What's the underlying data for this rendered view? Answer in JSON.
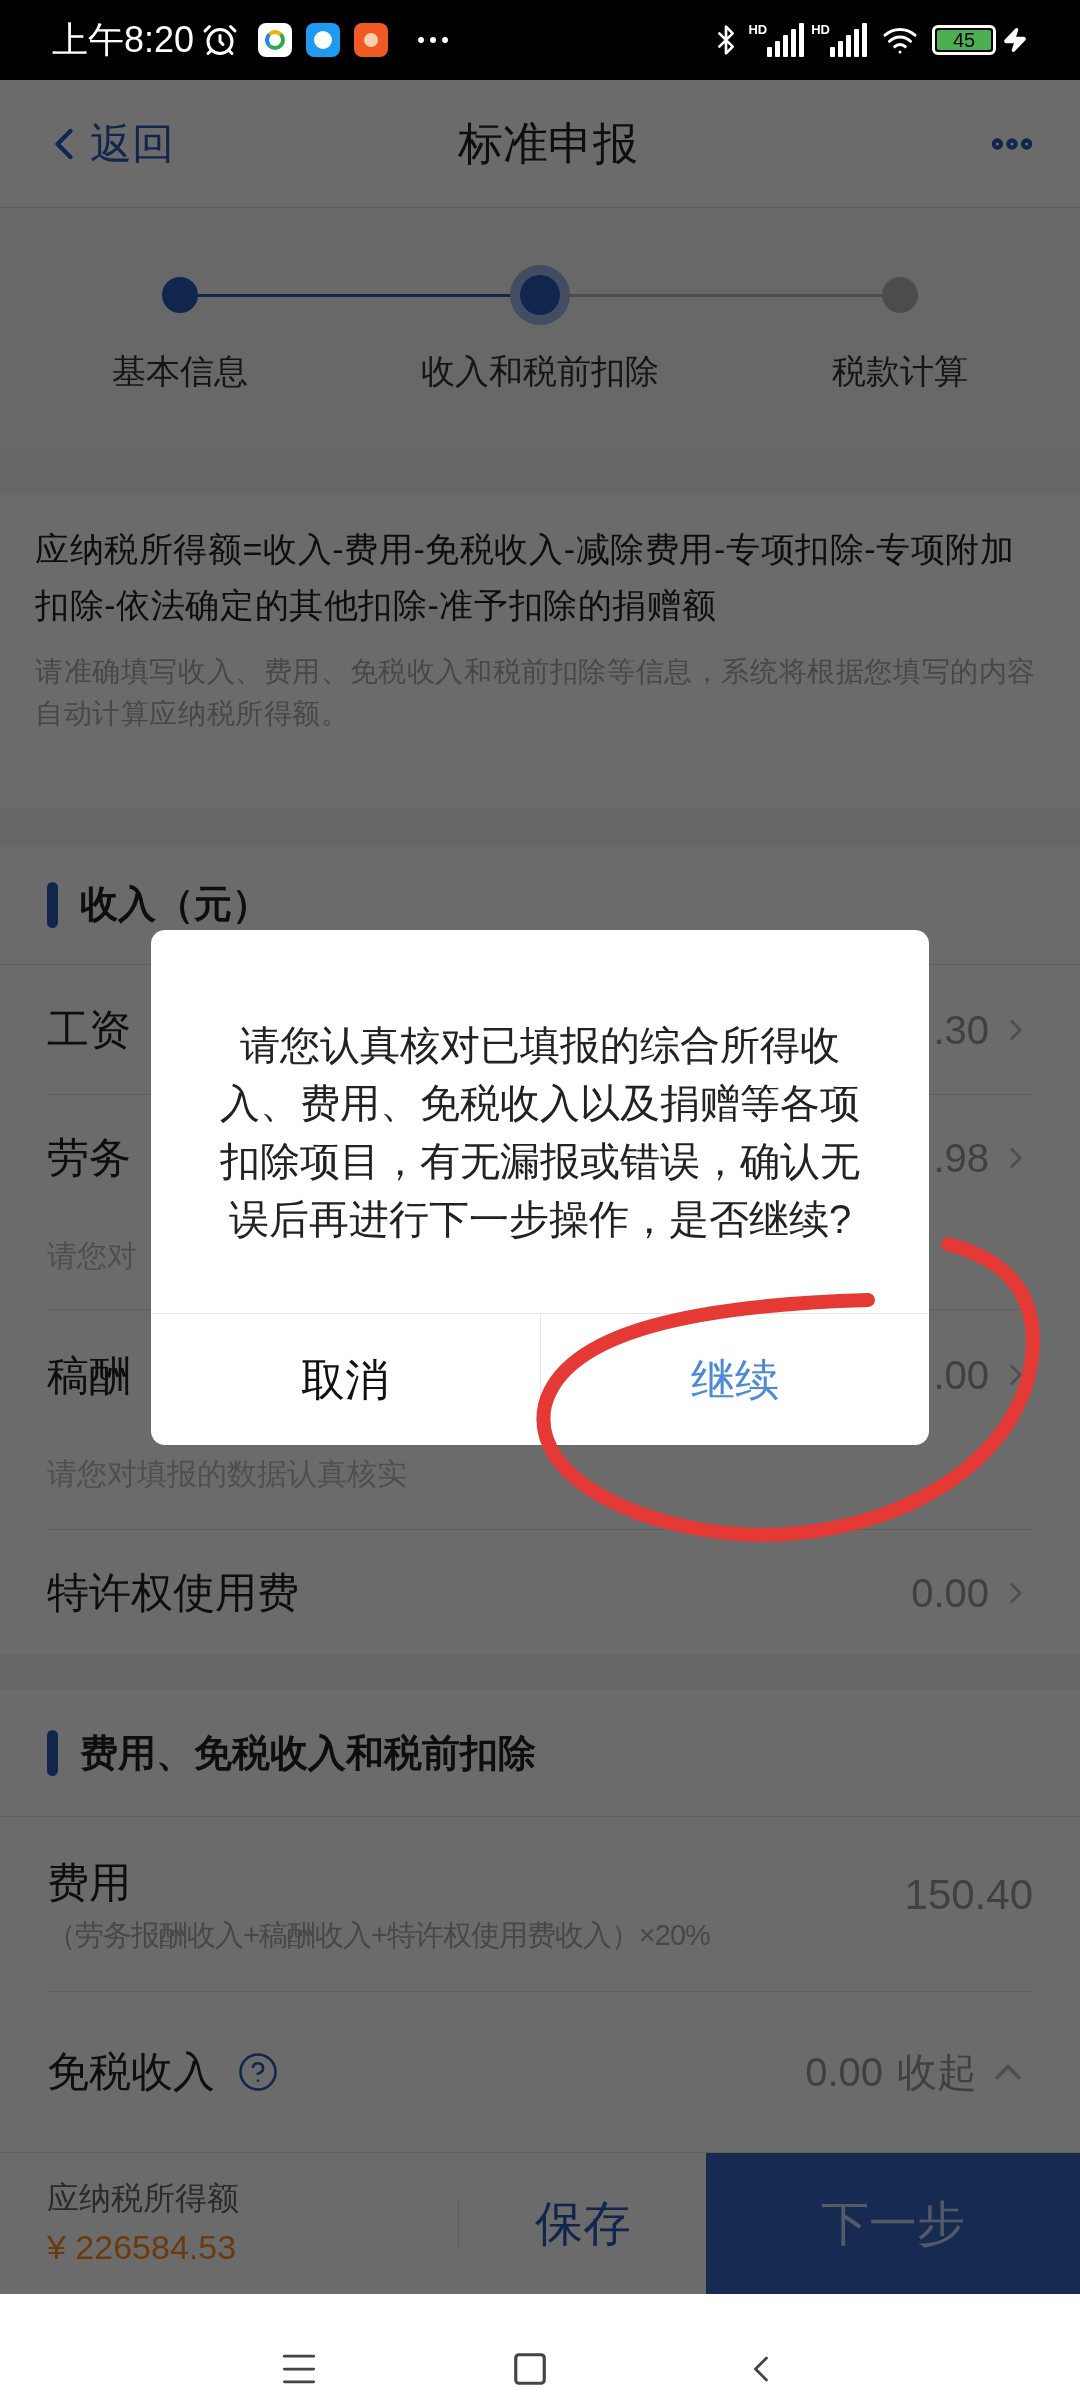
{
  "status_bar": {
    "time": "上午8:20",
    "signal_labels": [
      "HD",
      "HD"
    ],
    "battery": "45"
  },
  "header": {
    "back": "返回",
    "title": "标准申报"
  },
  "steps": [
    {
      "label": "基本信息",
      "done": true,
      "selected": false
    },
    {
      "label": "收入和税前扣除",
      "done": true,
      "selected": true
    },
    {
      "label": "税款计算",
      "done": false,
      "selected": false
    }
  ],
  "formula": {
    "text": "应纳税所得额=收入-费用-免税收入-减除费用-专项扣除-专项附加扣除-依法确定的其他扣除-准予扣除的捐赠额",
    "hint": "请准确填写收入、费用、免税收入和税前扣除等信息，系统将根据您填写的内容自动计算应纳税所得额。"
  },
  "income": {
    "title": "收入（元）",
    "rows": [
      {
        "label": "工资",
        "value": ".30"
      },
      {
        "label": "劳务",
        "value": ".98",
        "note": "请您对"
      },
      {
        "label": "稿酬",
        "value": ".00",
        "note": "请您对填报的数据认真核实"
      },
      {
        "label": "特许权使用费",
        "value": "0.00"
      }
    ]
  },
  "deductions": {
    "title": "费用、免税收入和税前扣除",
    "rows": [
      {
        "kind": "formula",
        "label": "费用",
        "sub": "（劳务报酬收入+稿酬收入+特许权使用费收入）×20%",
        "value": "150.40"
      },
      {
        "kind": "collapsible",
        "label": "免税收入",
        "value": "0.00",
        "toggle": "收起",
        "expanded": true
      }
    ]
  },
  "bottom_bar": {
    "label": "应纳税所得额",
    "amount": "¥ 226584.53",
    "save": "保存",
    "next": "下一步"
  },
  "dialog": {
    "message": "请您认真核对已填报的综合所得收入、费用、免税收入以及捐赠等各项扣除项目，有无漏报或错误，确认无误后再进行下一步操作，是否继续?",
    "cancel": "取消",
    "confirm": "继续"
  }
}
